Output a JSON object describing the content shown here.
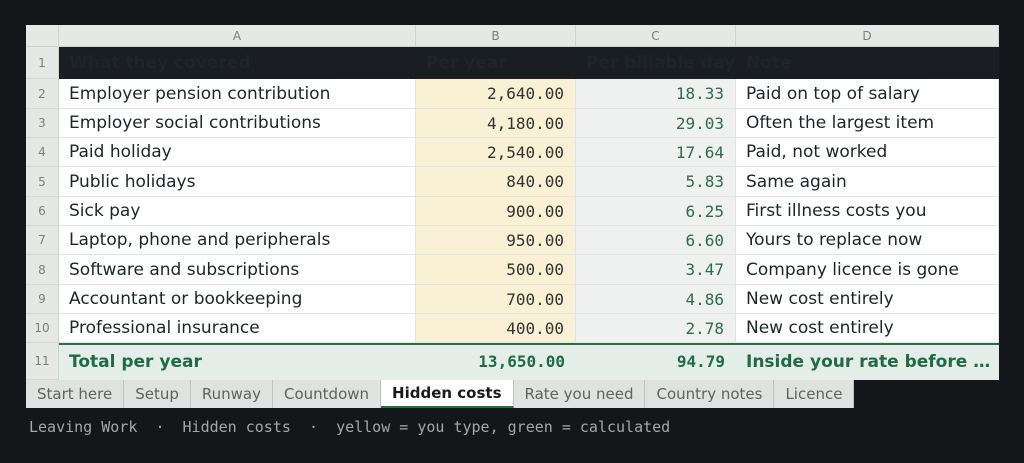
{
  "columns": [
    "A",
    "B",
    "C",
    "D"
  ],
  "row_numbers": [
    "1",
    "2",
    "3",
    "4",
    "5",
    "6",
    "7",
    "8",
    "9",
    "10",
    "11"
  ],
  "header": {
    "covered": "What they covered",
    "per_year": "Per year",
    "per_day": "Per billable day",
    "note": "Note"
  },
  "rows": [
    {
      "covered": "Employer pension contribution",
      "per_year": "2,640.00",
      "per_day": "18.33",
      "note": "Paid on top of salary"
    },
    {
      "covered": "Employer social contributions",
      "per_year": "4,180.00",
      "per_day": "29.03",
      "note": "Often the largest item"
    },
    {
      "covered": "Paid holiday",
      "per_year": "2,540.00",
      "per_day": "17.64",
      "note": "Paid, not worked"
    },
    {
      "covered": "Public holidays",
      "per_year": "840.00",
      "per_day": "5.83",
      "note": "Same again"
    },
    {
      "covered": "Sick pay",
      "per_year": "900.00",
      "per_day": "6.25",
      "note": "First illness costs you"
    },
    {
      "covered": "Laptop, phone and peripherals",
      "per_year": "950.00",
      "per_day": "6.60",
      "note": "Yours to replace now"
    },
    {
      "covered": "Software and subscriptions",
      "per_year": "500.00",
      "per_day": "3.47",
      "note": "Company licence is gone"
    },
    {
      "covered": "Accountant or bookkeeping",
      "per_year": "700.00",
      "per_day": "4.86",
      "note": "New cost entirely"
    },
    {
      "covered": "Professional insurance",
      "per_year": "400.00",
      "per_day": "2.78",
      "note": "New cost entirely"
    }
  ],
  "total": {
    "covered": "Total per year",
    "per_year": "13,650.00",
    "per_day": "94.79",
    "note": "Inside your rate before yo..."
  },
  "tabs": [
    {
      "label": "Start here",
      "active": false
    },
    {
      "label": "Setup",
      "active": false
    },
    {
      "label": "Runway",
      "active": false
    },
    {
      "label": "Countdown",
      "active": false
    },
    {
      "label": "Hidden costs",
      "active": true
    },
    {
      "label": "Rate you need",
      "active": false
    },
    {
      "label": "Country notes",
      "active": false
    },
    {
      "label": "Licence",
      "active": false
    }
  ],
  "footer": {
    "app": "Leaving Work",
    "sep": "·",
    "sheet": "Hidden costs",
    "legend": "yellow = you type, green = calculated"
  },
  "colors": {
    "input_cell": "#faf0d3",
    "calc_cell": "#eff1f1",
    "accent_green": "#2d6b4f",
    "header_bg": "#1a1e22"
  }
}
